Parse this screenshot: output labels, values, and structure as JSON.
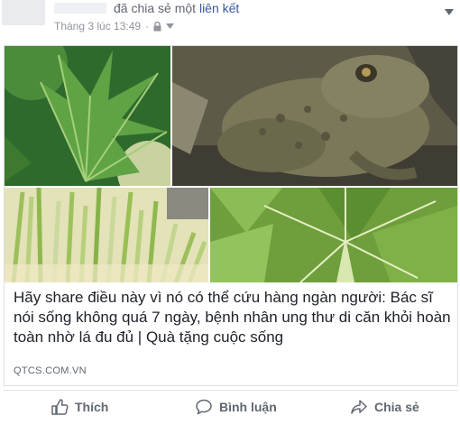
{
  "header": {
    "shared_text": "đã chia sẻ một",
    "shared_link": "liên kết",
    "timestamp": "Tháng 3 lúc 13:49",
    "separator": "·"
  },
  "card": {
    "title": "Hãy share điều này vì nó có thể cứu hàng ngàn người: Bác sĩ nói sống không quá 7 ngày, bệnh nhân ung thư di căn khỏi hoàn toàn nhờ lá đu đủ | Quà tặng cuộc sống",
    "source": "QTCS.COM.VN"
  },
  "actions": {
    "like_label": "Thích",
    "comment_label": "Bình luận",
    "share_label": "Chia sẻ"
  },
  "colors": {
    "link": "#365899",
    "meta": "#90949c",
    "action": "#606770"
  },
  "icons": [
    "lock-icon",
    "caret-down-icon",
    "like-icon",
    "comment-icon",
    "share-icon"
  ]
}
